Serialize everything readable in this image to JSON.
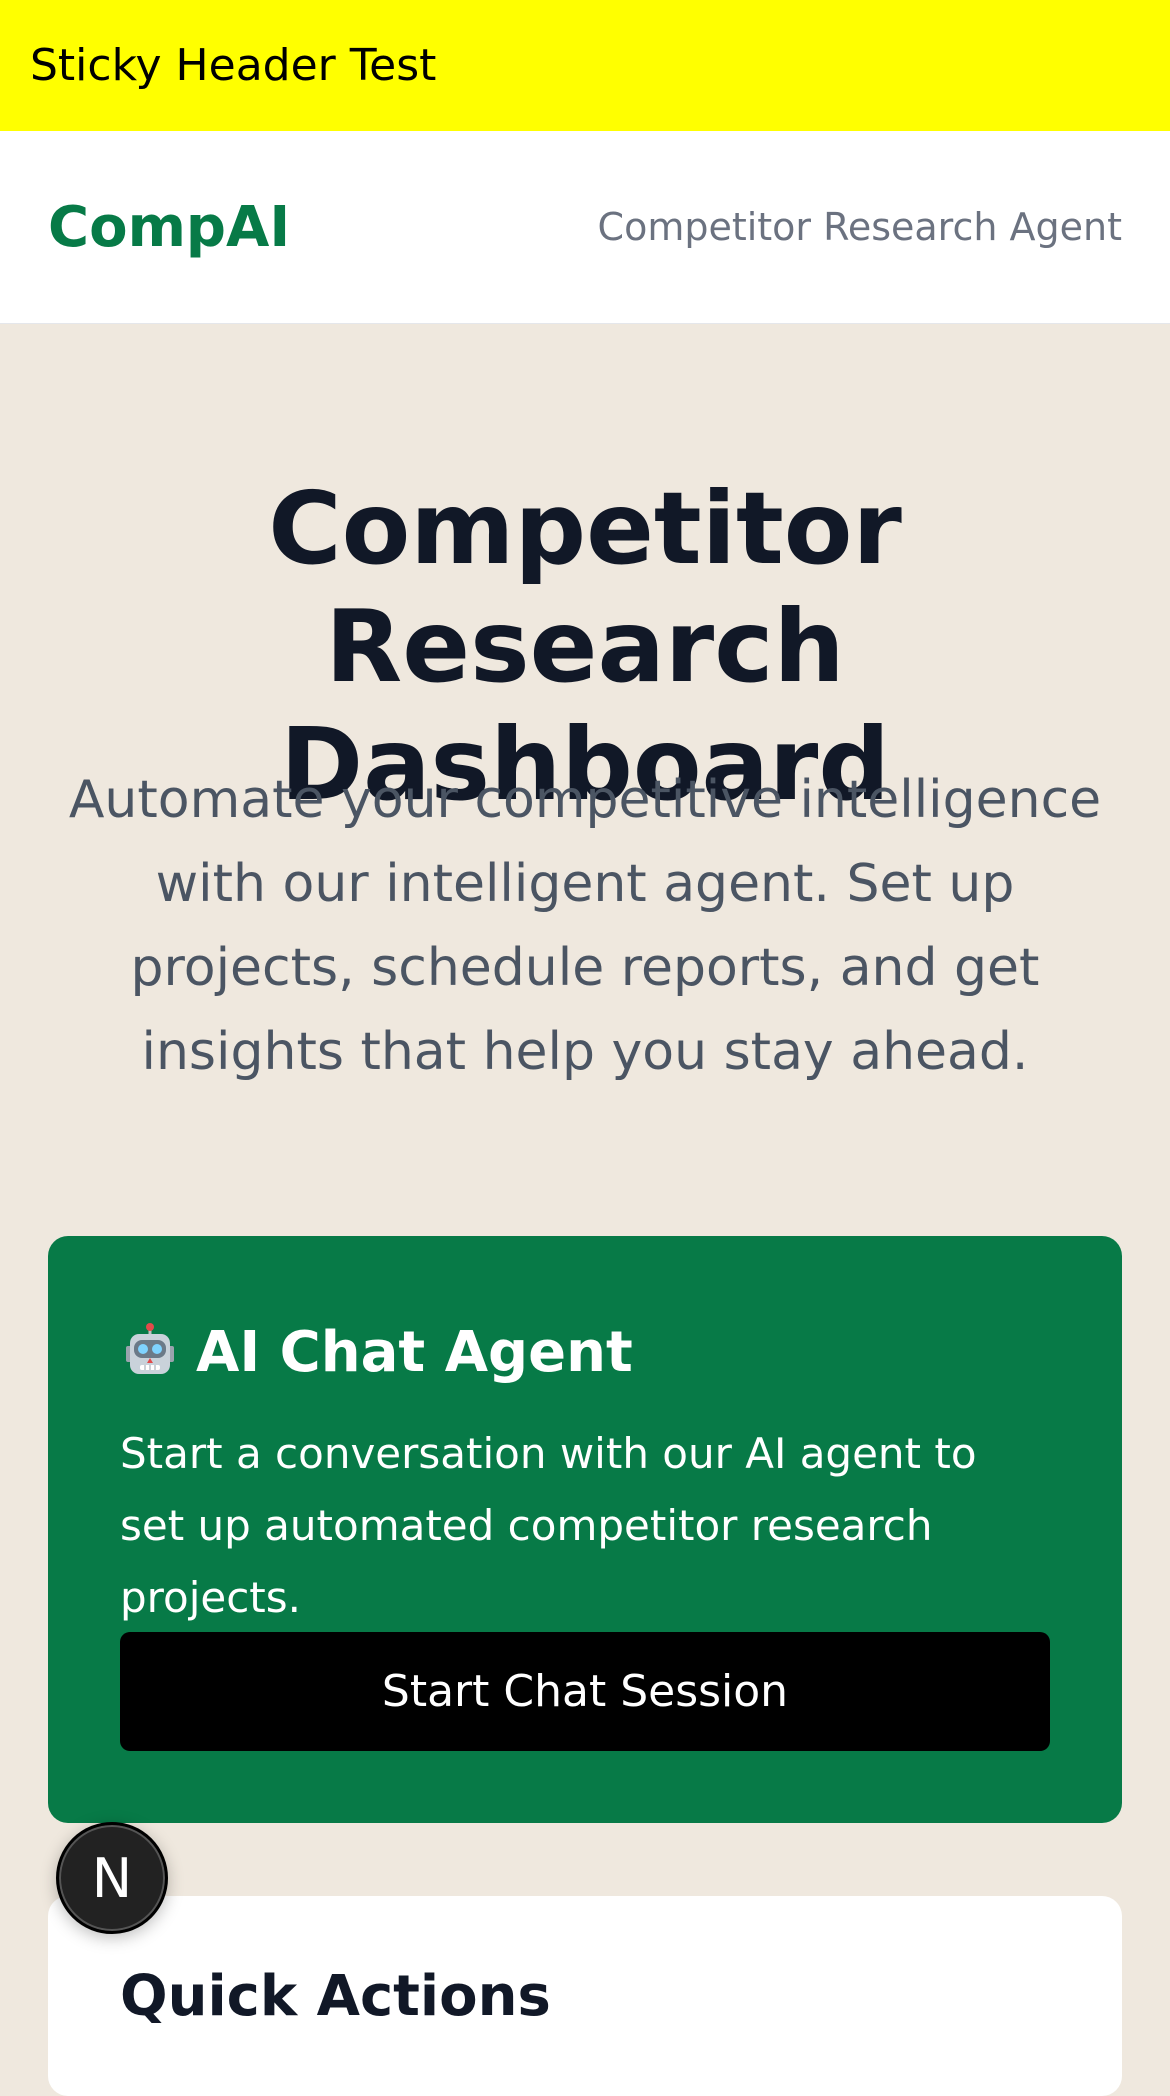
{
  "sticky_header": {
    "text": "Sticky Header Test",
    "bg_color": "#ffff00"
  },
  "nav": {
    "brand": "CompAI",
    "subtitle": "Competitor Research Agent",
    "brand_color": "#077a47"
  },
  "hero": {
    "title": "Competitor Research Dashboard",
    "description": "Automate your competitive intelligence with our intelligent agent. Set up projects, schedule reports, and get insights that help you stay ahead."
  },
  "chat_card": {
    "icon": "robot-icon",
    "title": "AI Chat Agent",
    "description": "Start a conversation with our AI agent to set up automated competitor research projects.",
    "button_label": "Start Chat Session",
    "bg_color": "#077a47"
  },
  "quick_card": {
    "title": "Quick Actions"
  },
  "fab": {
    "icon": "nextjs-logo-icon",
    "letter": "N"
  }
}
